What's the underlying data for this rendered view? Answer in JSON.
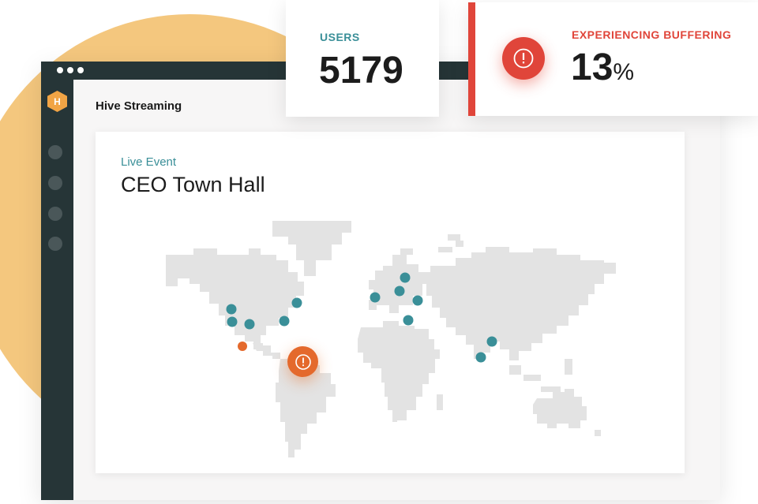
{
  "window": {
    "app_name": "Hive Streaming",
    "logo_letter": "H"
  },
  "event": {
    "label": "Live Event",
    "title": "CEO Town Hall"
  },
  "stats": {
    "users": {
      "label": "USERS",
      "value": "5179"
    },
    "buffering": {
      "label": "EXPERIENCING BUFFERING",
      "value": "13",
      "unit": "%"
    }
  },
  "colors": {
    "teal": "#3a8f98",
    "alert_red": "#e0453a",
    "alert_orange": "#e4692c",
    "sidebar": "#263537",
    "yellow": "#f4c77e",
    "map_land": "#e3e3e3"
  },
  "icons": {
    "alert": "exclamation-circle-icon",
    "logo": "hexagon-logo-icon"
  }
}
